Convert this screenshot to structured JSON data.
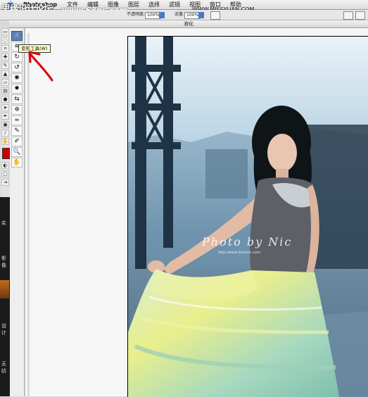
{
  "watermarks": {
    "site_left": "思缘设计论坛",
    "site_mid": "www.68ps.com",
    "site_right": "WWW.MISSYUAN.COM"
  },
  "menubar": {
    "app_name": "Photoshop",
    "items": [
      "文件",
      "编辑",
      "图像",
      "图层",
      "选择",
      "滤镜",
      "视图",
      "窗口",
      "帮助"
    ]
  },
  "options_bar": {
    "opacity_label": "不透明度:",
    "opacity_value": "100%",
    "flow_label": "流量:",
    "flow_value": "100%"
  },
  "window": {
    "title": "液化"
  },
  "liquify_tools": [
    {
      "name": "forward-warp-tool",
      "icon": "warp-icon",
      "glyph": "☝",
      "active": true
    },
    {
      "name": "reconstruct-tool",
      "icon": "reconstruct-icon",
      "glyph": "≋",
      "active": false
    },
    {
      "name": "twirl-clockwise-tool",
      "icon": "twirl-cw-icon",
      "glyph": "↻",
      "active": false
    },
    {
      "name": "twirl-counterclockwise-tool",
      "icon": "twirl-ccw-icon",
      "glyph": "↺",
      "active": false
    },
    {
      "name": "pucker-tool",
      "icon": "pucker-icon",
      "glyph": "✺",
      "active": false
    },
    {
      "name": "bloat-tool",
      "icon": "bloat-icon",
      "glyph": "✹",
      "active": false
    },
    {
      "name": "push-left-tool",
      "icon": "push-left-icon",
      "glyph": "⇆",
      "active": false
    },
    {
      "name": "mirror-tool",
      "icon": "mirror-icon",
      "glyph": "✲",
      "active": false
    },
    {
      "name": "turbulence-tool",
      "icon": "turbulence-icon",
      "glyph": "≈",
      "active": false
    },
    {
      "name": "freeze-mask-tool",
      "icon": "freeze-mask-icon",
      "glyph": "✎",
      "active": false
    },
    {
      "name": "thaw-mask-tool",
      "icon": "thaw-mask-icon",
      "glyph": "✐",
      "active": false
    },
    {
      "name": "zoom-tool",
      "icon": "zoom-icon",
      "glyph": "🔍",
      "active": false
    },
    {
      "name": "hand-tool",
      "icon": "hand-icon",
      "glyph": "✋",
      "active": false
    }
  ],
  "tooltip": {
    "text": "变形工具(W)"
  },
  "photo": {
    "watermark": "Photo by Nic",
    "watermark_sub": "http://www.ilovenic.com"
  },
  "desktop_strip": {
    "labels": [
      "实",
      "影像",
      "设计",
      "无纺"
    ]
  },
  "colors": {
    "accent": "#4a78c8",
    "arrow": "#d60000"
  }
}
